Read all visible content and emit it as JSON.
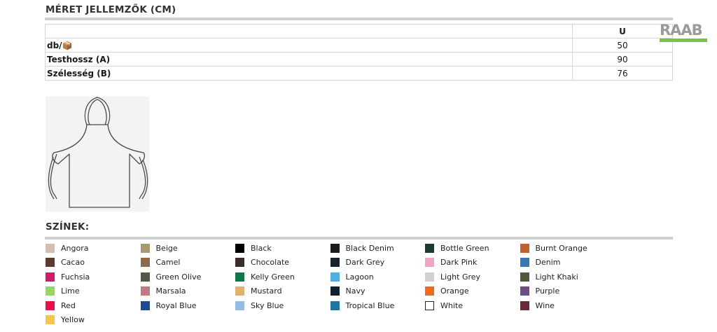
{
  "size_section": {
    "title": "MÉRET JELLEMZŐK (CM)",
    "size_header": "U",
    "rows": [
      {
        "label": "db/📦",
        "value": "50"
      },
      {
        "label": "Testhossz (A)",
        "value": "90"
      },
      {
        "label": "Szélesség (B)",
        "value": "76"
      }
    ]
  },
  "logo": {
    "text": "RAAB",
    "color": "#7dc242"
  },
  "colors_section": {
    "title": "SZÍNEK:",
    "items": [
      {
        "name": "Angora",
        "hex": "#d2bfae"
      },
      {
        "name": "Beige",
        "hex": "#a89a6c"
      },
      {
        "name": "Black",
        "hex": "#000000"
      },
      {
        "name": "Black Denim",
        "hex": "#1c1c1f"
      },
      {
        "name": "Bottle Green",
        "hex": "#1c3b32"
      },
      {
        "name": "Burnt Orange",
        "hex": "#c4602a"
      },
      {
        "name": "Cacao",
        "hex": "#5c3a32"
      },
      {
        "name": "Camel",
        "hex": "#8c6a4a"
      },
      {
        "name": "Chocolate",
        "hex": "#3d2c2c"
      },
      {
        "name": "Dark Grey",
        "hex": "#1c2229"
      },
      {
        "name": "Dark Pink",
        "hex": "#f2a4c6"
      },
      {
        "name": "Denim",
        "hex": "#3a78b4"
      },
      {
        "name": "Fuchsia",
        "hex": "#d41a6c"
      },
      {
        "name": "Green Olive",
        "hex": "#4f5a48"
      },
      {
        "name": "Kelly Green",
        "hex": "#0a7a4a"
      },
      {
        "name": "Lagoon",
        "hex": "#4cb0e6"
      },
      {
        "name": "Light Grey",
        "hex": "#d0d0d0"
      },
      {
        "name": "Light Khaki",
        "hex": "#55583c"
      },
      {
        "name": "Lime",
        "hex": "#96d662"
      },
      {
        "name": "Marsala",
        "hex": "#c07a80"
      },
      {
        "name": "Mustard",
        "hex": "#e0b468"
      },
      {
        "name": "Navy",
        "hex": "#111d30"
      },
      {
        "name": "Orange",
        "hex": "#f26a1a"
      },
      {
        "name": "Purple",
        "hex": "#6e4c88"
      },
      {
        "name": "Red",
        "hex": "#e5104c"
      },
      {
        "name": "Royal Blue",
        "hex": "#1c4c96"
      },
      {
        "name": "Sky Blue",
        "hex": "#92bce6"
      },
      {
        "name": "Tropical Blue",
        "hex": "#1d78a0"
      },
      {
        "name": "White",
        "hex": "#ffffff"
      },
      {
        "name": "Wine",
        "hex": "#6a2a38"
      },
      {
        "name": "Yellow",
        "hex": "#f8c64e"
      }
    ]
  }
}
